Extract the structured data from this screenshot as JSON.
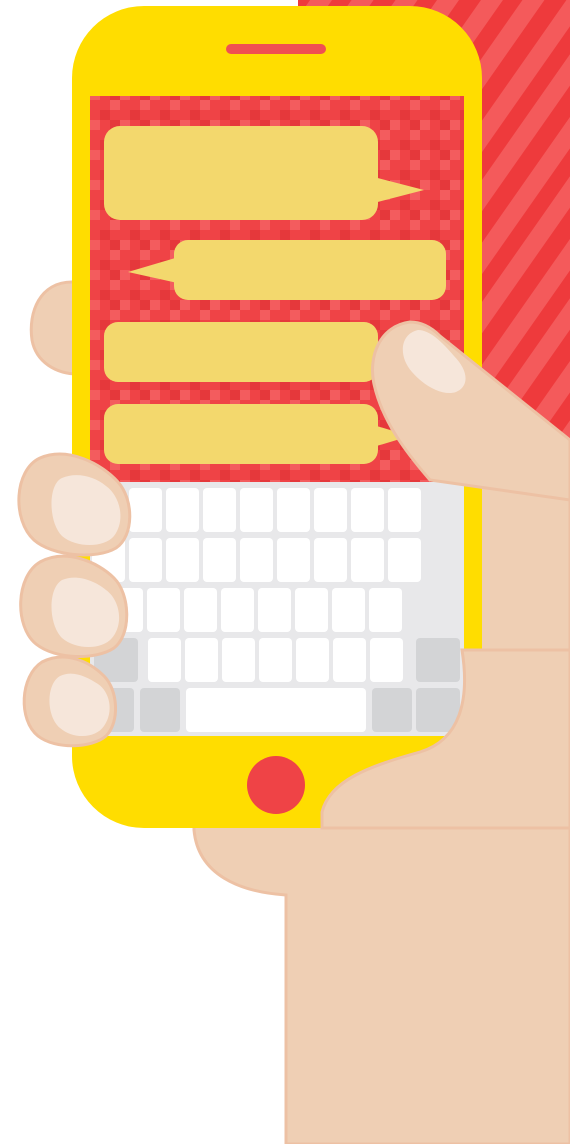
{
  "colors": {
    "background": "#FFFFFF",
    "backdrop_red": "#EE3A3C",
    "backdrop_stripe": "#F45A5B",
    "phone_body": "#FFDD00",
    "screen_red": "#EF4346",
    "screen_tile_light": "#F35C5E",
    "screen_tile_dark": "#E5383B",
    "chat_bubble": "#F3D86D",
    "speaker_grille": "#F05052",
    "home_button": "#EF4346",
    "keyboard_tray": "#E8E8EA",
    "key_light": "#FFFFFF",
    "key_dark": "#D3D4D6",
    "skin": "#EFCFB4",
    "skin_outline": "#EDC1A4",
    "fingernail": "#F6E6DA"
  },
  "phone": {
    "chat_bubbles": [
      {
        "side": "outgoing"
      },
      {
        "side": "incoming"
      },
      {
        "side": "outgoing"
      },
      {
        "side": "outgoing"
      }
    ],
    "keyboard": {
      "rows": [
        9,
        9,
        8,
        7,
        5
      ]
    }
  },
  "icons": {
    "speaker": "speaker-grille-icon",
    "home": "home-button-icon"
  }
}
